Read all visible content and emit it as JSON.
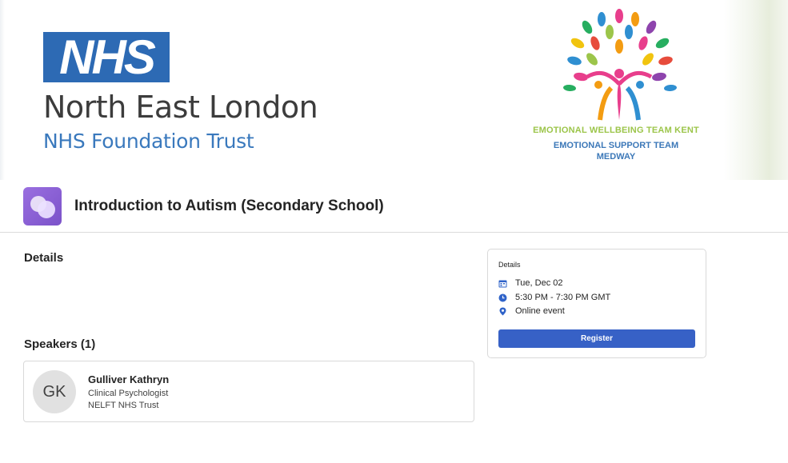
{
  "banner": {
    "logo_text": "NHS",
    "org_name": "North East London",
    "org_sub": "NHS Foundation Trust",
    "partner_line1": "EMOTIONAL WELLBEING TEAM KENT",
    "partner_line2": "EMOTIONAL SUPPORT TEAM",
    "partner_line3": "MEDWAY",
    "colors": {
      "nhs_blue": "#2d6ab4",
      "partner_green": "#9cc54a",
      "partner_blue": "#3c78b8"
    }
  },
  "event": {
    "title": "Introduction to Autism (Secondary School)",
    "icon": "event-bubbles-icon",
    "accent": "#7b52c9"
  },
  "details_section": {
    "heading": "Details"
  },
  "speakers_section": {
    "heading": "Speakers (1)",
    "speakers": [
      {
        "initials": "GK",
        "name": "Gulliver Kathryn",
        "role": "Clinical Psychologist",
        "organization": "NELFT NHS Trust"
      }
    ]
  },
  "details_card": {
    "title": "Details",
    "date": "Tue, Dec 02",
    "time": "5:30 PM - 7:30 PM GMT",
    "location": "Online event",
    "register_label": "Register",
    "icons": [
      "calendar-icon",
      "clock-icon",
      "location-pin-icon"
    ],
    "button_color": "#3761c6"
  }
}
